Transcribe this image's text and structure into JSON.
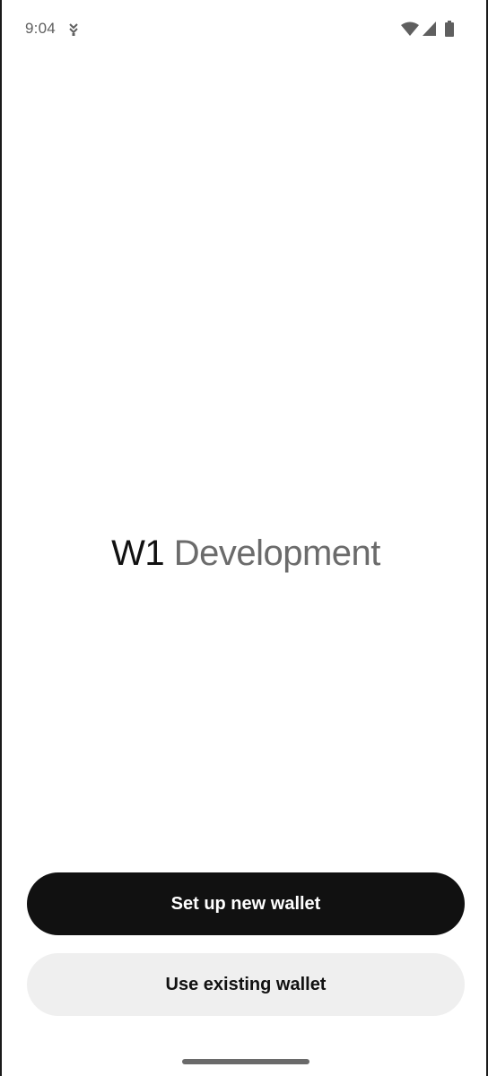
{
  "status_bar": {
    "time": "9:04",
    "icons": [
      "notification-icon",
      "wifi-icon",
      "cell-signal-icon",
      "battery-icon"
    ]
  },
  "wordmark": {
    "primary": "W1",
    "secondary": "Development"
  },
  "actions": {
    "primary_label": "Set up new wallet",
    "secondary_label": "Use existing wallet"
  },
  "colors": {
    "primary_button_bg": "#111111",
    "secondary_button_bg": "#efefef",
    "wordmark_secondary": "#6b6b6b"
  }
}
